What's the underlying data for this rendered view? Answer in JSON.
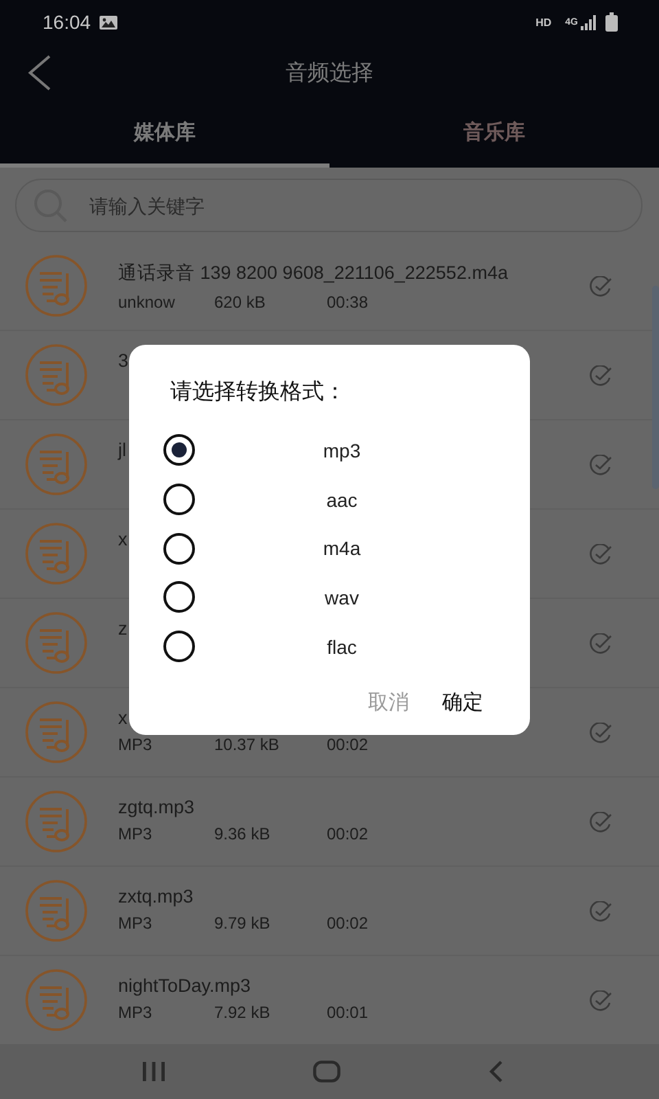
{
  "status_bar": {
    "time": "16:04",
    "network": "HD",
    "signal_type": "4G"
  },
  "header": {
    "title": "音频选择"
  },
  "tabs": [
    {
      "label": "媒体库",
      "selected": true
    },
    {
      "label": "音乐库",
      "selected": false
    }
  ],
  "search": {
    "placeholder": "请输入关键字"
  },
  "files": [
    {
      "name": "通话录音 139 8200 9608_221106_222552.m4a",
      "format": "unknow",
      "size": "620 kB",
      "duration": "00:38"
    },
    {
      "name": "3"
    },
    {
      "name": "jl"
    },
    {
      "name": "x"
    },
    {
      "name": "z"
    },
    {
      "name": "x",
      "format": "MP3",
      "size": "10.37 kB",
      "duration": "00:02"
    },
    {
      "name": "zgtq.mp3",
      "format": "MP3",
      "size": "9.36 kB",
      "duration": "00:02"
    },
    {
      "name": "zxtq.mp3",
      "format": "MP3",
      "size": "9.79 kB",
      "duration": "00:02"
    },
    {
      "name": "nightToDay.mp3",
      "format": "MP3",
      "size": "7.92 kB",
      "duration": "00:01"
    }
  ],
  "dialog": {
    "title": "请选择转换格式：",
    "options": [
      {
        "label": "mp3",
        "selected": true
      },
      {
        "label": "aac",
        "selected": false
      },
      {
        "label": "m4a",
        "selected": false
      },
      {
        "label": "wav",
        "selected": false
      },
      {
        "label": "flac",
        "selected": false
      }
    ],
    "buttons": [
      {
        "label": "取消",
        "kind": "cancel"
      },
      {
        "label": "确定",
        "kind": "confirm"
      }
    ]
  }
}
